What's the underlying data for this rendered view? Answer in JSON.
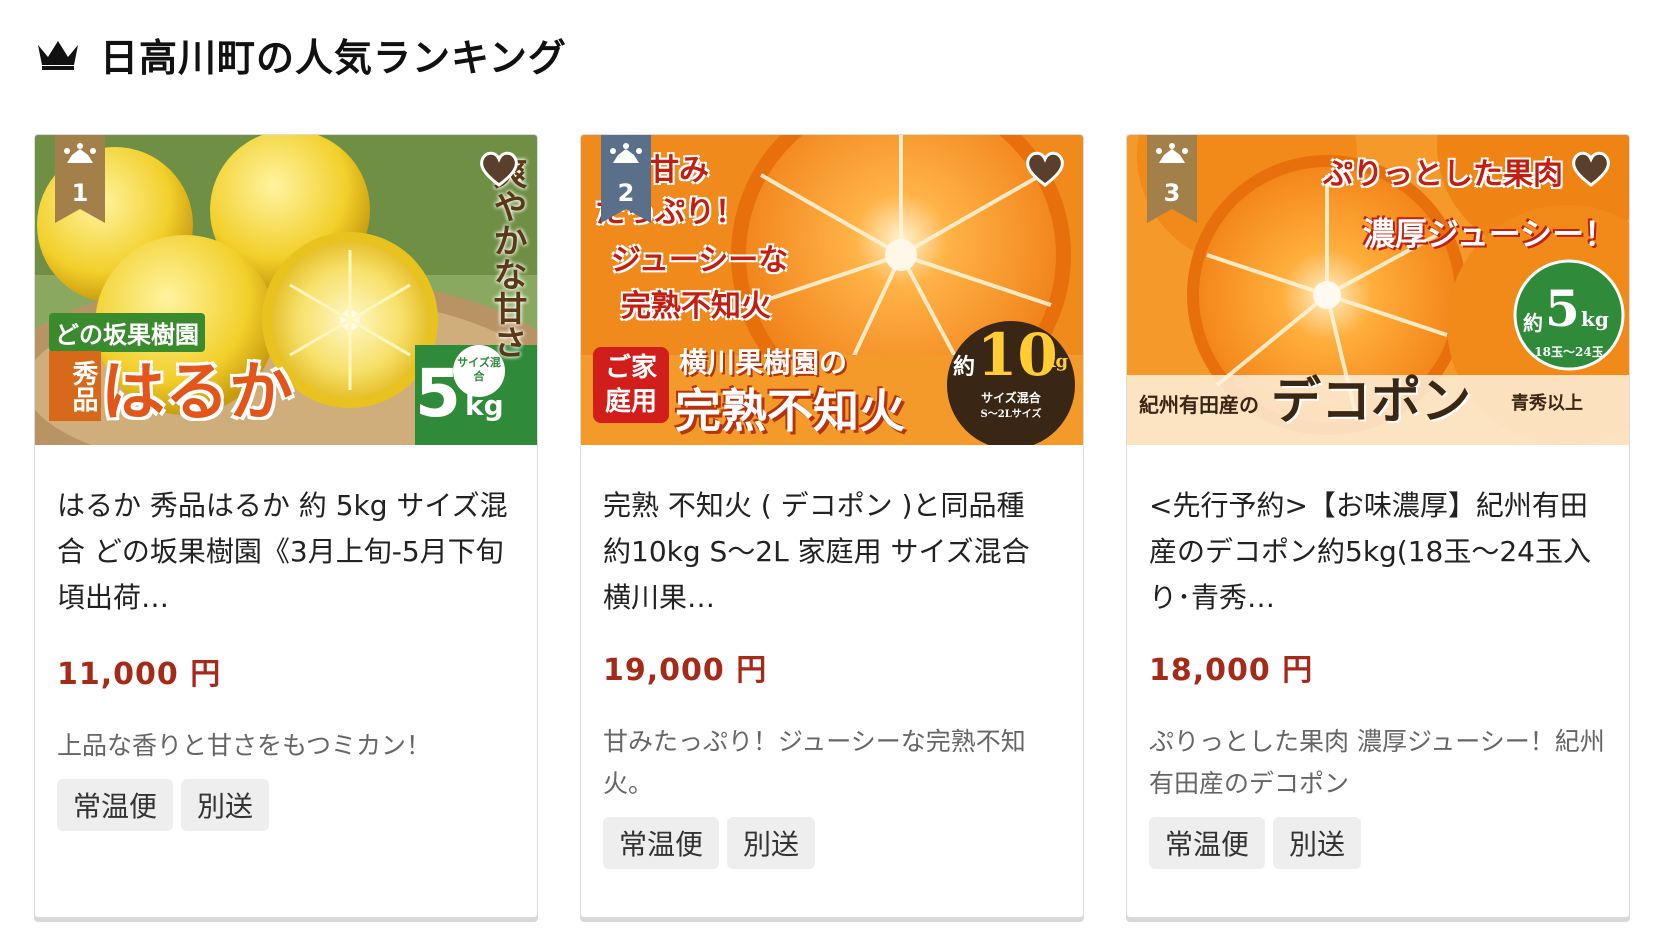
{
  "section": {
    "title": "日高川町の人気ランキング",
    "icon": "crown-icon"
  },
  "colors": {
    "rank_badge": "#a3804a",
    "rank_badge_2": "#5a6f8a",
    "price": "#a62a1a",
    "tag_bg": "#eeeeee"
  },
  "cards": [
    {
      "rank": "1",
      "title": "はるか 秀品はるか 約 5kg サイズ混合 どの坂果樹園《3月上旬-5月下旬頃出荷…",
      "price": "11,000 円",
      "description": "上品な香りと甘さをもつミカン！",
      "tags": [
        "常温便",
        "別送"
      ],
      "image": {
        "producer": "どの坂果樹園",
        "grade": "秀品",
        "name": "はるか",
        "weight": "5",
        "unit": "kg",
        "size_note": "サイズ混合",
        "tagline": "爽やかな甘さ"
      }
    },
    {
      "rank": "2",
      "title": "完熟 不知火 ( デコポン )と同品種 約10kg S～2L 家庭用 サイズ混合 横川果…",
      "price": "19,000 円",
      "description": "甘みたっぷり！ジューシーな完熟不知火。",
      "tags": [
        "常温便",
        "別送"
      ],
      "image": {
        "catch1": "甘み",
        "catch2": "たっぷり！",
        "catch3": "ジューシーな",
        "catch4": "完熟不知火",
        "badge": "ご家庭用",
        "producer": "横川果樹園の",
        "name": "完熟不知火",
        "weight_prefix": "約",
        "weight": "10",
        "unit": "kg",
        "size_note": "サイズ混合",
        "size_range": "S～2Lサイズ"
      }
    },
    {
      "rank": "3",
      "title": "<先行予約>【お味濃厚】紀州有田産のデコポン約5kg(18玉～24玉入り･青秀…",
      "price": "18,000 円",
      "description": "ぷりっとした果肉 濃厚ジューシー！紀州有田産のデコポン",
      "tags": [
        "常温便",
        "別送"
      ],
      "image": {
        "catch1": "ぷりっとした果肉",
        "catch2": "濃厚ジューシー！",
        "origin": "紀州有田産の",
        "name": "デコポン",
        "weight_prefix": "約",
        "weight": "5",
        "unit": "kg",
        "count": "18玉～24玉",
        "grade": "青秀以上"
      }
    }
  ]
}
